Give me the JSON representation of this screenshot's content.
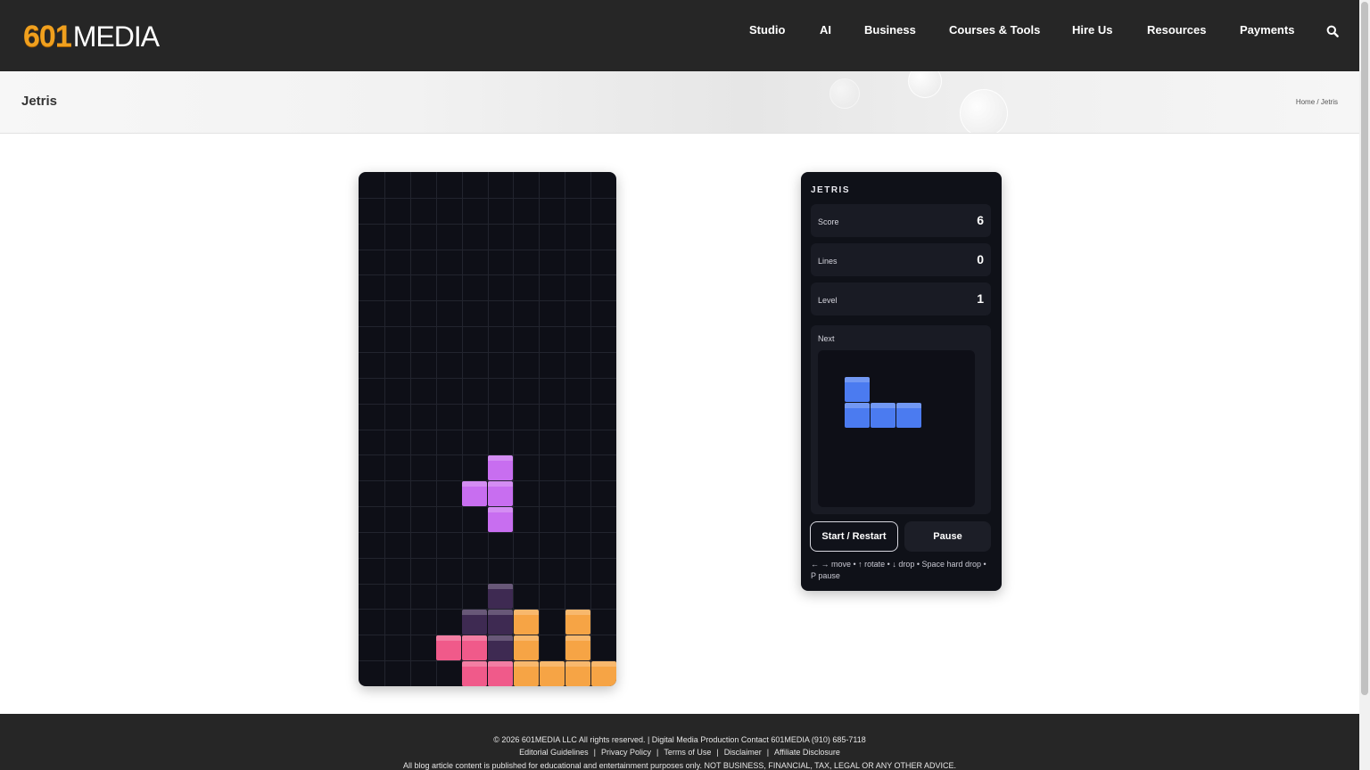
{
  "header": {
    "logo_number": "601",
    "logo_word": "MEDIA",
    "nav": [
      {
        "label": "Studio",
        "key": "studio"
      },
      {
        "label": "AI",
        "key": "ai"
      },
      {
        "label": "Business",
        "key": "business"
      },
      {
        "label": "Courses & Tools",
        "key": "courses-tools"
      },
      {
        "label": "Hire Us",
        "key": "hire-us"
      },
      {
        "label": "Resources",
        "key": "resources"
      },
      {
        "label": "Payments",
        "key": "payments"
      }
    ],
    "search_icon": "search-icon"
  },
  "titlebar": {
    "title": "Jetris",
    "breadcrumb_home": "Home",
    "breadcrumb_sep": "/",
    "breadcrumb_current": "Jetris"
  },
  "board": {
    "cols": 10,
    "rows": 20,
    "colors": {
      "T": "#c86ef0",
      "ghost": "#3e2a52",
      "Z": "#f05a8a",
      "L": "#f6a445",
      "J": "#4b7bf0"
    },
    "active_piece": {
      "type": "T",
      "cells": [
        [
          5,
          11
        ],
        [
          4,
          12
        ],
        [
          5,
          12
        ],
        [
          5,
          13
        ]
      ]
    },
    "ghost_piece": {
      "type": "ghost",
      "cells": [
        [
          5,
          16
        ],
        [
          4,
          17
        ],
        [
          5,
          17
        ],
        [
          5,
          18
        ]
      ]
    },
    "locked": [
      {
        "type": "L",
        "cells": [
          [
            6,
            17
          ],
          [
            8,
            17
          ],
          [
            6,
            18
          ],
          [
            8,
            18
          ],
          [
            6,
            19
          ],
          [
            7,
            19
          ],
          [
            8,
            19
          ],
          [
            9,
            19
          ]
        ]
      },
      {
        "type": "Z",
        "cells": [
          [
            3,
            18
          ],
          [
            4,
            18
          ],
          [
            4,
            19
          ],
          [
            5,
            19
          ]
        ]
      }
    ]
  },
  "panel": {
    "title": "JETRIS",
    "stats": [
      {
        "label": "Score",
        "value": "6"
      },
      {
        "label": "Lines",
        "value": "0"
      },
      {
        "label": "Level",
        "value": "1"
      }
    ],
    "next_label": "Next",
    "next_piece": {
      "type": "J",
      "cells": [
        [
          0,
          0
        ],
        [
          0,
          1
        ],
        [
          1,
          1
        ],
        [
          2,
          1
        ]
      ]
    },
    "start_label": "Start / Restart",
    "pause_label": "Pause",
    "help_text": "← → move • ↑ rotate • ↓ drop • Space hard drop • P pause"
  },
  "footer": {
    "line1": "© 2026   601MEDIA LLC   All rights reserved. | Digital Media Production Contact 601MEDIA (910) 685-7118",
    "links": [
      "Editorial Guidelines",
      "Privacy Policy",
      "Terms of Use",
      "Disclaimer",
      "Affiliate Disclosure"
    ],
    "link_sep": "|",
    "line3": "All blog article content is published for educational and entertainment purposes only. NOT BUSINESS, FINANCIAL, TAX, LEGAL OR ANY OTHER ADVICE."
  }
}
